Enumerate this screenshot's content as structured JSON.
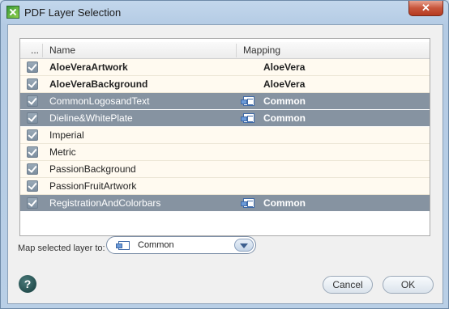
{
  "window": {
    "title": "PDF Layer Selection",
    "close_glyph": "✕"
  },
  "grid": {
    "columns": {
      "check": "...",
      "name": "Name",
      "mapping": "Mapping"
    },
    "rows": [
      {
        "name": "AloeVeraArtwork",
        "mapping": "AloeVera",
        "checked": true,
        "selected": false,
        "bold": true
      },
      {
        "name": "AloeVeraBackground",
        "mapping": "AloeVera",
        "checked": true,
        "selected": false,
        "bold": true
      },
      {
        "name": "CommonLogosandText",
        "mapping": "Common",
        "checked": true,
        "selected": true,
        "bold": false
      },
      {
        "name": "Dieline&WhitePlate",
        "mapping": "Common",
        "checked": true,
        "selected": true,
        "bold": false
      },
      {
        "name": "Imperial",
        "mapping": "",
        "checked": true,
        "selected": false,
        "bold": false
      },
      {
        "name": "Metric",
        "mapping": "",
        "checked": true,
        "selected": false,
        "bold": false
      },
      {
        "name": "PassionBackground",
        "mapping": "",
        "checked": true,
        "selected": false,
        "bold": false
      },
      {
        "name": "PassionFruitArtwork",
        "mapping": "",
        "checked": true,
        "selected": false,
        "bold": false
      },
      {
        "name": "RegistrationAndColorbars",
        "mapping": "Common",
        "checked": true,
        "selected": true,
        "bold": false
      }
    ]
  },
  "footer": {
    "map_label": "Map selected layer to:",
    "dropdown_value": "Common",
    "help_glyph": "?",
    "cancel_label": "Cancel",
    "ok_label": "OK"
  }
}
